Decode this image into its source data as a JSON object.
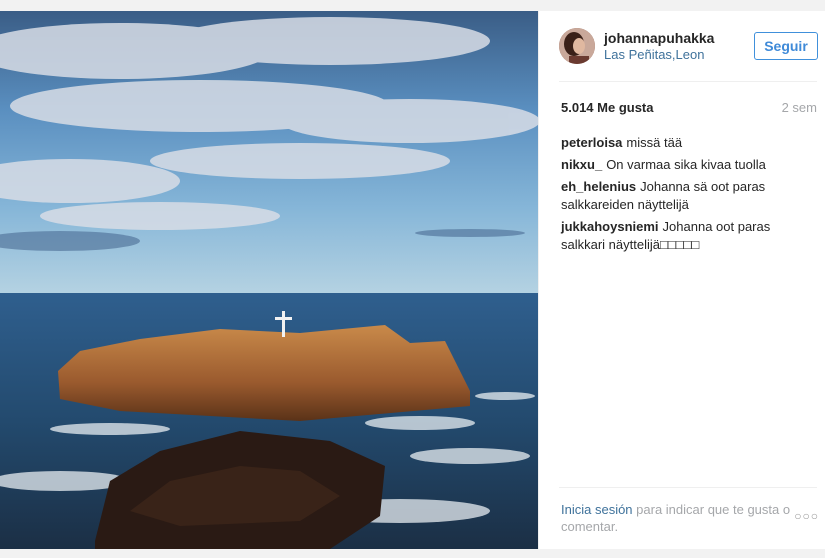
{
  "post": {
    "username": "johannapuhakka",
    "location": "Las Peñitas,Leon",
    "follow_label": "Seguir",
    "likes": "5.014 Me gusta",
    "time_ago": "2 sem",
    "comments": [
      {
        "user": "peterloisa",
        "text": "missä tää"
      },
      {
        "user": "nikxu_",
        "text": "On varmaa sika kivaa tuolla"
      },
      {
        "user": "eh_helenius",
        "text": "Johanna sä oot paras salkkareiden näyttelijä"
      },
      {
        "user": "jukkahoysniemi",
        "text": "Johanna oot paras salkkari näyttelijä□□□□□"
      }
    ],
    "footer": {
      "login_link": "Inicia sesión",
      "rest": " para indicar que te gusta o comentar."
    },
    "more_label": "○○○"
  },
  "icons": {
    "photo": "seascape-photo",
    "avatar": "user-avatar"
  }
}
